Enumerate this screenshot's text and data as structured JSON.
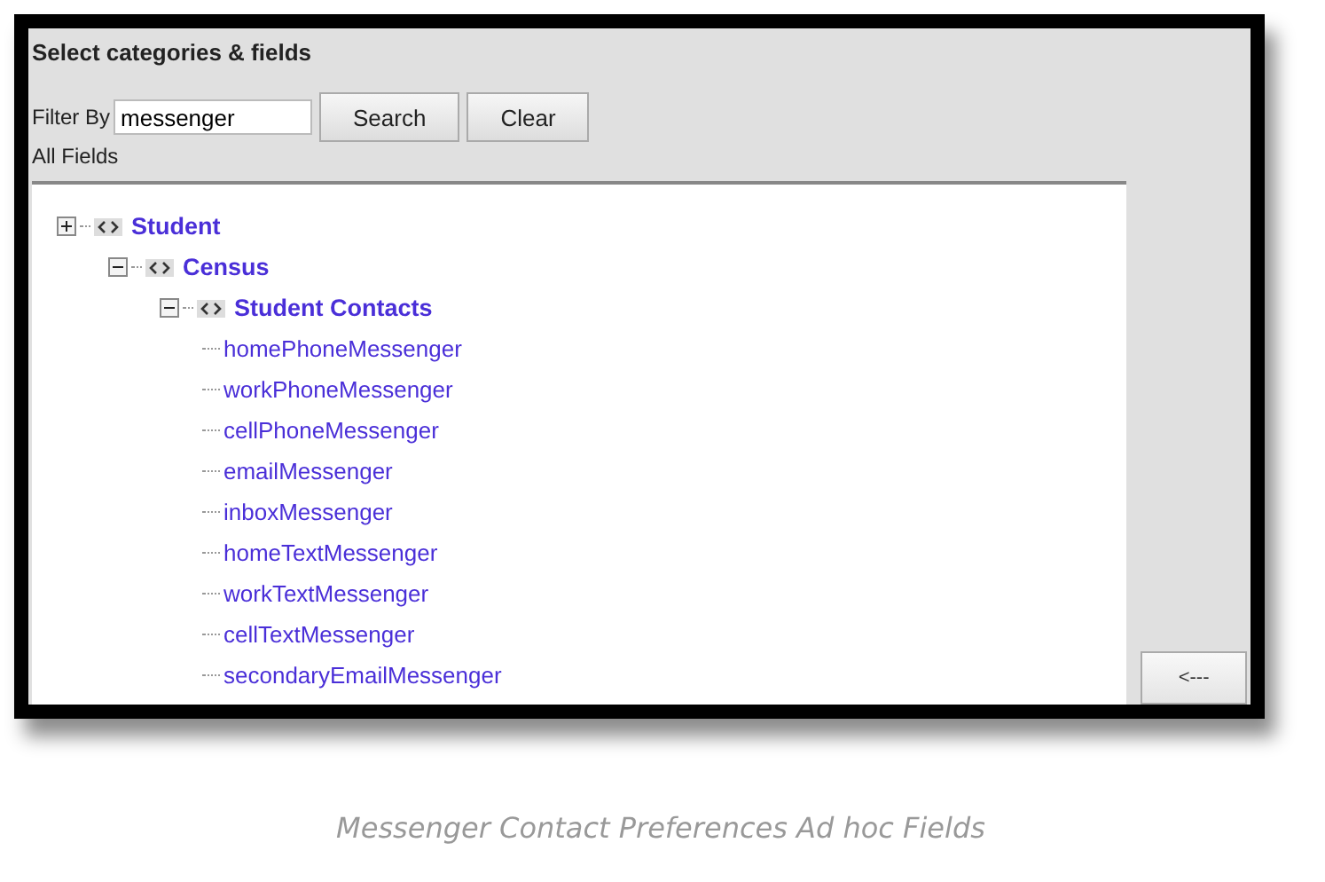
{
  "panel": {
    "title": "Select categories & fields",
    "filter": {
      "label": "Filter By",
      "value": "messenger"
    },
    "buttons": [
      "Search",
      "Clear"
    ],
    "tree_label": "All Fields",
    "tree": [
      {
        "label": "Student",
        "kind": "category",
        "expanded": false,
        "children": [
          {
            "label": "Census",
            "kind": "category",
            "expanded": true,
            "children": [
              {
                "label": "Student Contacts",
                "kind": "category",
                "expanded": true,
                "children": [
                  {
                    "label": "homePhoneMessenger",
                    "kind": "field"
                  },
                  {
                    "label": "workPhoneMessenger",
                    "kind": "field"
                  },
                  {
                    "label": "cellPhoneMessenger",
                    "kind": "field"
                  },
                  {
                    "label": "emailMessenger",
                    "kind": "field"
                  },
                  {
                    "label": "inboxMessenger",
                    "kind": "field"
                  },
                  {
                    "label": "homeTextMessenger",
                    "kind": "field"
                  },
                  {
                    "label": "workTextMessenger",
                    "kind": "field"
                  },
                  {
                    "label": "cellTextMessenger",
                    "kind": "field"
                  },
                  {
                    "label": "secondaryEmailMessenger",
                    "kind": "field"
                  }
                ]
              }
            ]
          }
        ]
      }
    ],
    "move_button": "<---"
  },
  "caption": "Messenger Contact Preferences Ad hoc Fields"
}
